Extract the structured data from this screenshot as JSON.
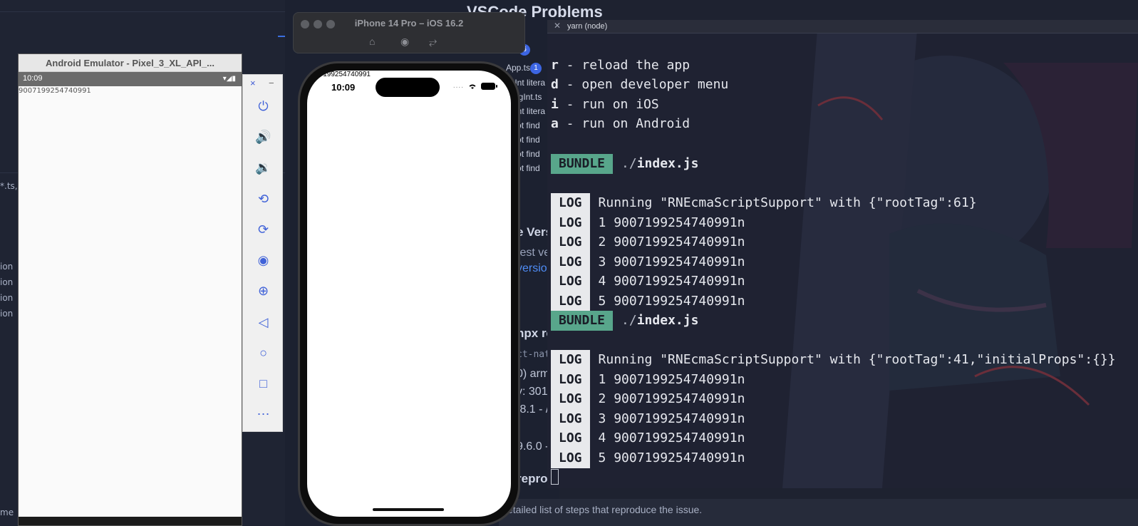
{
  "background": {
    "vscode_title": "VSCode Problems",
    "problems_count": "6",
    "app_file": "App.tsx",
    "app_file_count": "1",
    "problem_rows": [
      "BigInt litera",
      "ckBigInt.ts",
      "BigInt litera",
      "annot find",
      "annot find",
      "annot find",
      "annot find"
    ],
    "section_version": "e Vers",
    "test_ver": "test ver",
    "version_link": "version",
    "npx_info": "npx react-native info",
    "mono_line": "ct-nati",
    "arm_line": "0) arm",
    "mem_line": "y: 301.",
    "ver_line": ".8.1 - /",
    "xcode_line": "9.6.0 -",
    "reproduce": "reproduc",
    "reproduce_desc": "etailed list of steps that reproduce the issue.",
    "left_snippet": "*.ts,",
    "left_ion_lines": [
      "ion",
      "ion",
      "ion",
      "ion"
    ],
    "left_bottom": "me"
  },
  "ios_sim": {
    "title": "iPhone 14 Pro – iOS 16.2",
    "time": "10:09",
    "overlay_text": "9007199254740991",
    "status_dots": "....",
    "icons": [
      "home-icon",
      "screenshot-icon",
      "rotate-icon"
    ]
  },
  "android": {
    "title": "Android Emulator - Pixel_3_XL_API_...",
    "time": "10:09",
    "status_icons": "▾◢▮",
    "text": "9007199254740991",
    "panel_close": "×",
    "panel_min": "−",
    "panel_buttons": [
      "power-icon",
      "volume-up-icon",
      "volume-down-icon",
      "rotate-left-icon",
      "rotate-right-icon",
      "camera-icon",
      "zoom-icon",
      "back-icon",
      "home-icon",
      "overview-icon",
      "more-icon"
    ]
  },
  "terminal": {
    "title": "yarn (node)",
    "menu": [
      {
        "key": "r",
        "text": " - reload the app"
      },
      {
        "key": "d",
        "text": " - open developer menu"
      },
      {
        "key": "i",
        "text": " - run on iOS"
      },
      {
        "key": "a",
        "text": " - run on Android"
      }
    ],
    "bundle_tag": "BUNDLE",
    "bundle_path_dim": "./",
    "bundle_path_file": "index.js",
    "log_tag": "LOG",
    "block1_running": "Running \"RNEcmaScriptSupport\" with {\"rootTag\":61}",
    "block1_logs": [
      "1 9007199254740991n",
      "2 9007199254740991n",
      "3 9007199254740991n",
      "4 9007199254740991n",
      "5 9007199254740991n"
    ],
    "block2_running": "Running \"RNEcmaScriptSupport\" with {\"rootTag\":41,\"initialProps\":{}}",
    "block2_logs": [
      "1 9007199254740991n",
      "2 9007199254740991n",
      "3 9007199254740991n",
      "4 9007199254740991n",
      "5 9007199254740991n"
    ]
  }
}
